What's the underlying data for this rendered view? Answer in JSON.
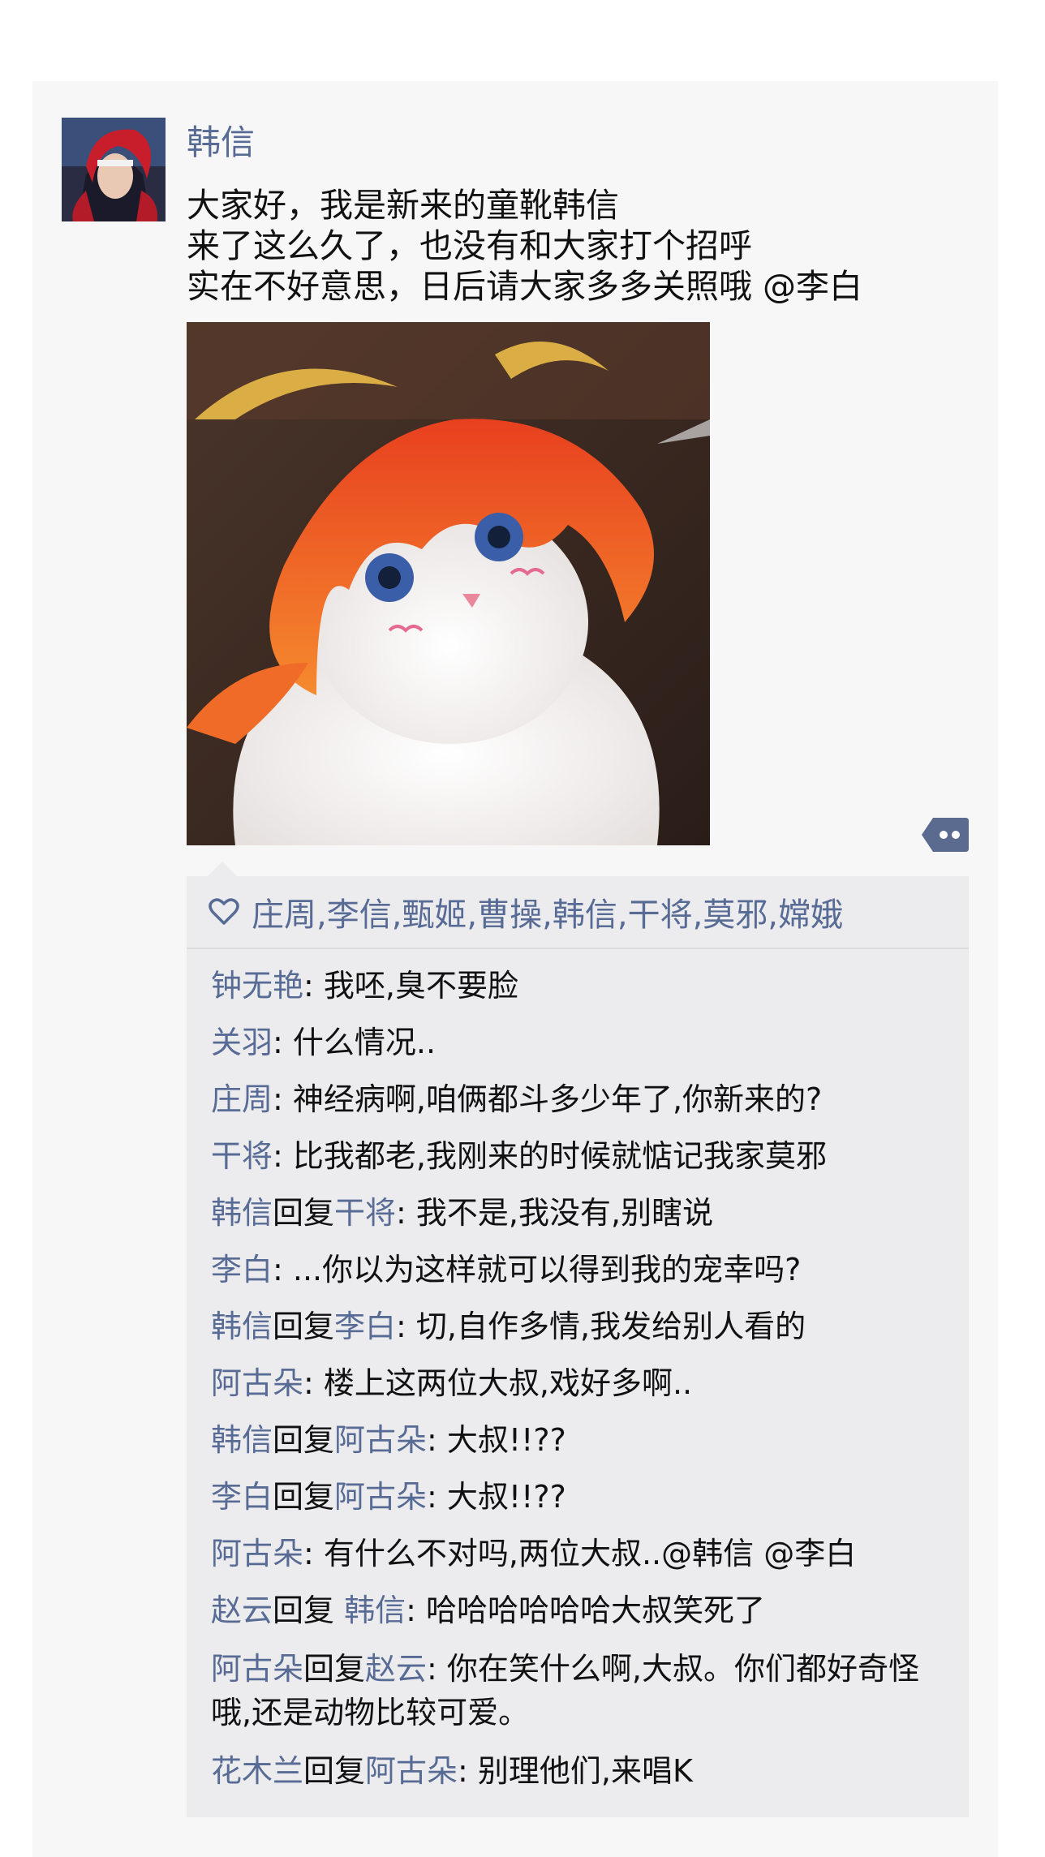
{
  "post": {
    "author": "韩信",
    "text_lines": [
      "大家好，我是新来的童靴韩信",
      "来了这么久了，也没有和大家打个招呼",
      "实在不好意思，日后请大家多多关照哦  @李白"
    ]
  },
  "likes": {
    "names": "庄周,李信,甄姬,曹操,韩信,干将,莫邪,嫦娥"
  },
  "comments": [
    {
      "from": "钟无艳",
      "reply_word": "",
      "to": "",
      "text": ": 我呸,臭不要脸"
    },
    {
      "from": "关羽",
      "reply_word": "",
      "to": "",
      "text": ": 什么情况.."
    },
    {
      "from": "庄周",
      "reply_word": "",
      "to": "",
      "text": ": 神经病啊,咱俩都斗多少年了,你新来的?"
    },
    {
      "from": "干将",
      "reply_word": "",
      "to": "",
      "text": ": 比我都老,我刚来的时候就惦记我家莫邪"
    },
    {
      "from": "韩信",
      "reply_word": "回复",
      "to": "干将",
      "text": ": 我不是,我没有,别瞎说"
    },
    {
      "from": "李白",
      "reply_word": "",
      "to": "",
      "text": ": ...你以为这样就可以得到我的宠幸吗?"
    },
    {
      "from": "韩信",
      "reply_word": "回复",
      "to": "李白",
      "text": ": 切,自作多情,我发给别人看的"
    },
    {
      "from": "阿古朵",
      "reply_word": "",
      "to": "",
      "text": ": 楼上这两位大叔,戏好多啊.."
    },
    {
      "from": "韩信",
      "reply_word": "回复",
      "to": "阿古朵",
      "text": ": 大叔!!??"
    },
    {
      "from": "李白",
      "reply_word": "回复",
      "to": "阿古朵",
      "text": ": 大叔!!??"
    },
    {
      "from": "阿古朵",
      "reply_word": "",
      "to": "",
      "text": ": 有什么不对吗,两位大叔..@韩信 @李白"
    },
    {
      "from": "赵云",
      "reply_word": "回复 ",
      "to": "韩信",
      "text": ": 哈哈哈哈哈哈大叔笑死了"
    },
    {
      "from": "阿古朵",
      "reply_word": "回复",
      "to": "赵云",
      "text": ": 你在笑什么啊,大叔。你们都好奇怪哦,还是动物比较可爱。"
    },
    {
      "from": "花木兰",
      "reply_word": "回复",
      "to": "阿古朵",
      "text": ": 别理他们,来唱K"
    }
  ],
  "icons": {
    "like": "heart-outline-icon",
    "more": "comment-more-icon"
  },
  "colors": {
    "name_link": "#576b95",
    "panel": "#ececee",
    "card": "#f7f7f8"
  }
}
